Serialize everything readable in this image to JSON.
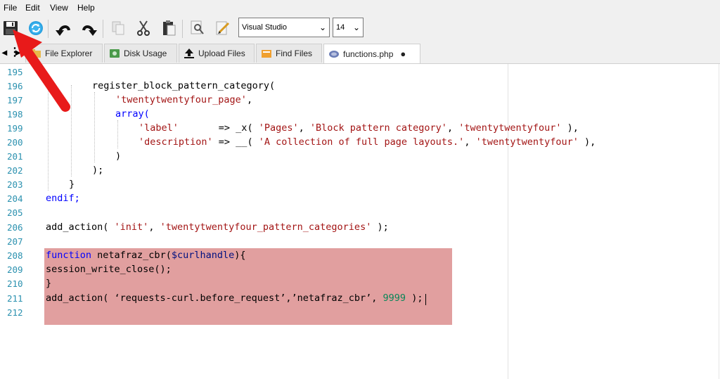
{
  "menu": [
    "File",
    "Edit",
    "View",
    "Help"
  ],
  "toolbar": {
    "icons": [
      "save-icon",
      "refresh-icon",
      "undo-icon",
      "redo-icon",
      "copy-icon",
      "cut-icon",
      "paste-icon",
      "find-icon",
      "edit-icon"
    ],
    "theme_select": "Visual Studio",
    "font_size_select": "14"
  },
  "tabs": [
    {
      "label": "File Explorer",
      "icon": "folder-icon"
    },
    {
      "label": "Disk Usage",
      "icon": "disk-icon"
    },
    {
      "label": "Upload Files",
      "icon": "upload-icon"
    },
    {
      "label": "Find Files",
      "icon": "find-files-icon"
    },
    {
      "label": "functions.php",
      "icon": "php-file-icon",
      "modified": "●"
    }
  ],
  "tab_nav": "⋮",
  "editor": {
    "line_numbers": [
      "195",
      "196",
      "197",
      "198",
      "199",
      "200",
      "201",
      "202",
      "203",
      "204",
      "205",
      "206",
      "207",
      "208",
      "209",
      "210",
      "211",
      "212"
    ],
    "code": {
      "l196": "register_block_pattern_category(",
      "l197": "'twentytwentyfour_page'",
      "l197b": ",",
      "l198": "array(",
      "l199a": "'label'",
      "l199b": "       => _x( ",
      "l199c": "'Pages'",
      "l199d": ", ",
      "l199e": "'Block pattern category'",
      "l199f": ", ",
      "l199g": "'twentytwentyfour'",
      "l199h": " ),",
      "l200a": "'description'",
      "l200b": " => __( ",
      "l200c": "'A collection of full page layouts.'",
      "l200d": ", ",
      "l200e": "'twentytwentyfour'",
      "l200f": " ),",
      "l201": ")",
      "l202": ");",
      "l203": "}",
      "l204": "endif;",
      "l206a": "add_action( ",
      "l206b": "'init'",
      "l206c": ", ",
      "l206d": "'twentytwentyfour_pattern_categories'",
      "l206e": " );",
      "l208a": "function",
      "l208b": " netafraz_cbr(",
      "l208c": "$curlhandle",
      "l208d": "){",
      "l209": "session_write_close();",
      "l210": "}",
      "l211a": "add_action( ‘requests-curl.before_request’,’netafraz_cbr’, ",
      "l211b": "9999",
      "l211c": " );"
    }
  },
  "colors": {
    "line_number": "#2b91af",
    "keyword": "#0000ff",
    "string": "#a31515",
    "number": "#098658",
    "highlight": "#dc8c8c",
    "arrow": "#e81a1a"
  }
}
